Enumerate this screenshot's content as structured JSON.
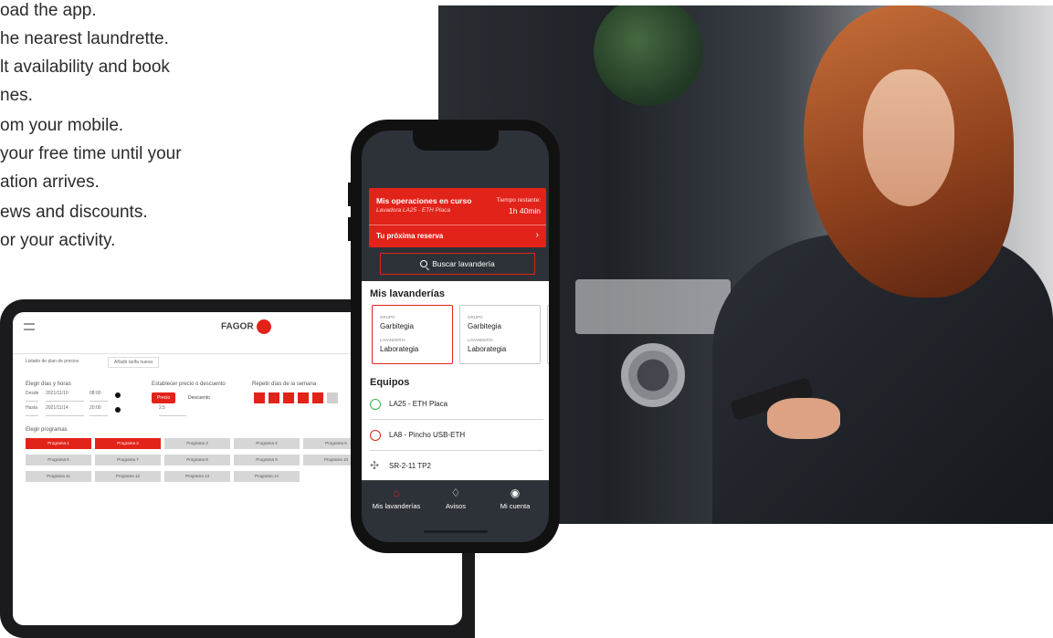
{
  "features": [
    "oad the app.",
    "he nearest laundrette.",
    "lt availability and book",
    "nes.",
    "om your mobile.",
    "your free time until your",
    "ation arrives.",
    "ews and discounts.",
    "or your activity."
  ],
  "tablet": {
    "logo": "FAGOR",
    "tab_left": "Listado de plan de precios",
    "tab_right": "Añadir tarifa nueva",
    "section_days": "Elegir días y horas",
    "from_label": "Desde",
    "from_date": "2021/11/10",
    "from_time": "08:00",
    "to_label": "Hasta",
    "to_date": "2021/11/14",
    "to_time": "20:00",
    "section_price": "Establecer precio o descuento",
    "price_button": "Precio",
    "discount_option": "Descuento",
    "price_value": "2,5",
    "section_repeat": "Repetir días de la semana",
    "day_labels": [
      "Lu",
      "Ma",
      "Mi",
      "Ju",
      "Vi"
    ],
    "section_programs": "Elegir programas",
    "programs": [
      "Programa 1",
      "Programa 2",
      "Programa 3",
      "Programa 4",
      "Programa 5",
      "Programa 6",
      "Programa 7",
      "Programa 8",
      "Programa 9",
      "Programa 10",
      "Programa 11",
      "Programa 12",
      "Programa 13",
      "Programa 14"
    ]
  },
  "phone": {
    "current_ops": {
      "title": "Mis operaciones en curso",
      "machine": "Lavadora LA25 - ETH Placa",
      "time_label": "Tiempo restante:",
      "time_value": "1h 40min",
      "next_booking": "Tu próxima reserva",
      "chevron": "›"
    },
    "search_label": "Buscar lavandería",
    "my_laundries_title": "Mis lavanderías",
    "laundries": [
      {
        "group_label": "GRUPO",
        "group": "Garbitegia",
        "laundry_label": "LAVANDERÍA",
        "laundry": "Laborategia"
      },
      {
        "group_label": "GRUPO",
        "group": "Garbitegia",
        "laundry_label": "LAVANDERÍA",
        "laundry": "Laborategia"
      }
    ],
    "equipment_title": "Equipos",
    "equipment": [
      {
        "label": "LA25 - ETH Placa",
        "status_color": "#3bb552"
      },
      {
        "label": "LA8 - Pincho USB-ETH",
        "status_color": "#e2231a"
      },
      {
        "label": "SR-2-11 TP2",
        "status_color": "#777777"
      }
    ],
    "nav": [
      {
        "label": "Mis lavanderías",
        "icon": "home-icon"
      },
      {
        "label": "Avisos",
        "icon": "bell-icon"
      },
      {
        "label": "Mi cuenta",
        "icon": "user-icon"
      }
    ]
  },
  "colors": {
    "accent": "#e2231a",
    "phone_bg": "#2d3238",
    "ok_green": "#3bb552"
  }
}
